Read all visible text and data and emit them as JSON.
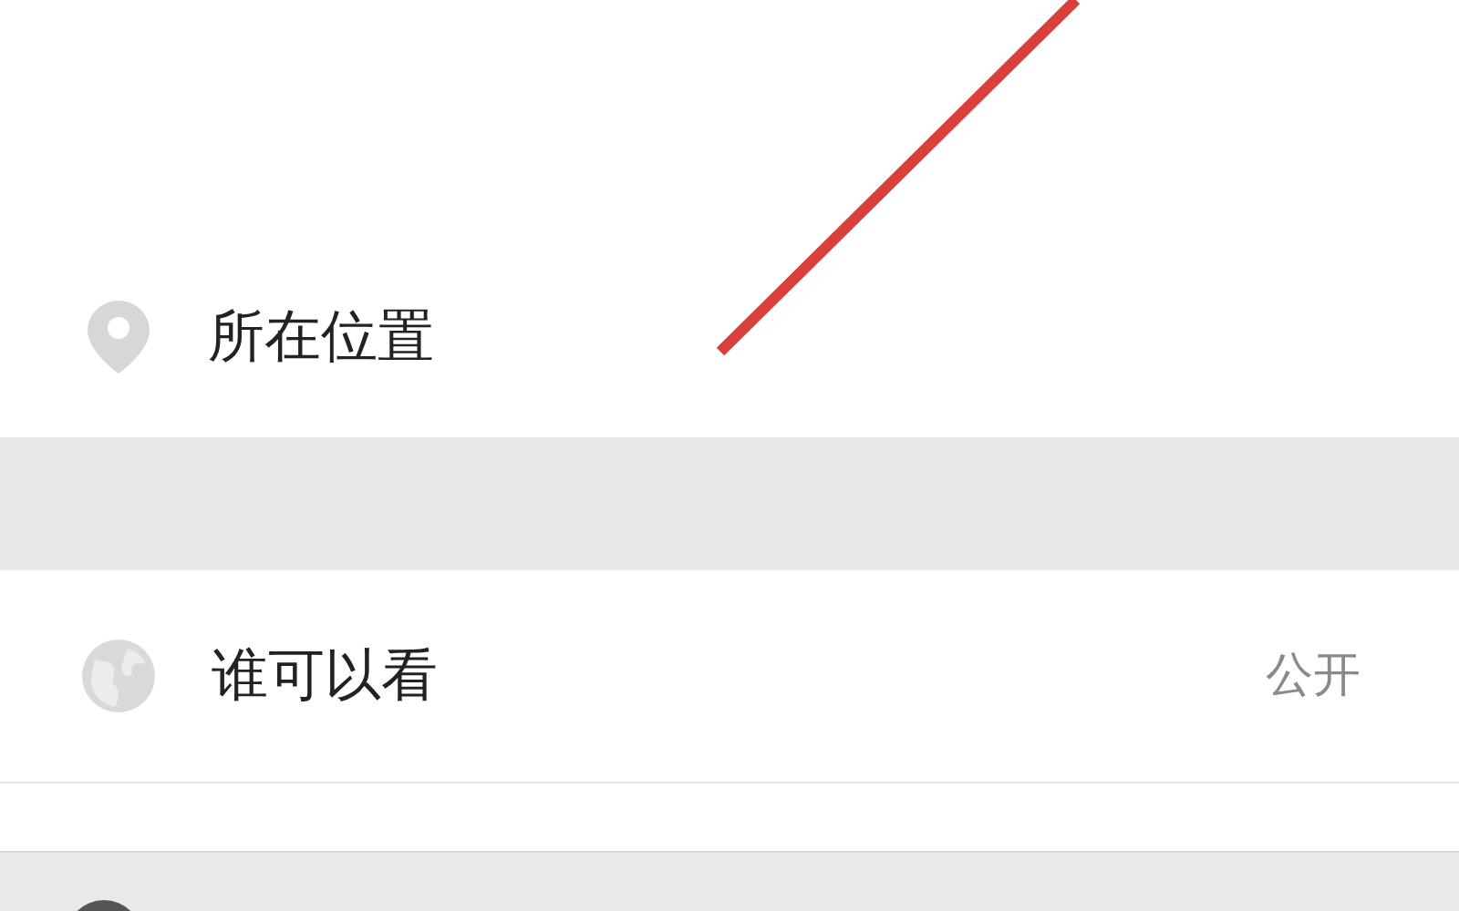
{
  "location_row": {
    "label": "所在位置"
  },
  "visibility_row": {
    "label": "谁可以看",
    "value": "公开"
  }
}
